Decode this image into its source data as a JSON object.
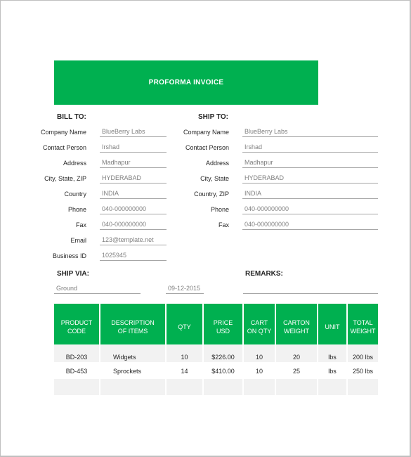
{
  "title": "PROFORMA INVOICE",
  "bill_to": {
    "heading": "BILL TO:",
    "fields": [
      {
        "label": "Company Name",
        "value": "BlueBerry Labs"
      },
      {
        "label": "Contact Person",
        "value": "Irshad"
      },
      {
        "label": "Address",
        "value": "Madhapur"
      },
      {
        "label": "City, State, ZIP",
        "value": "HYDERABAD"
      },
      {
        "label": "Country",
        "value": "INDIA"
      },
      {
        "label": "Phone",
        "value": "040-000000000"
      },
      {
        "label": "Fax",
        "value": "040-000000000"
      },
      {
        "label": "Email",
        "value": "123@template.net"
      },
      {
        "label": "Business ID",
        "value": "1025945"
      }
    ]
  },
  "ship_to": {
    "heading": "SHIP TO:",
    "fields": [
      {
        "label": "Company Name",
        "value": "BlueBerry Labs"
      },
      {
        "label": "Contact Person",
        "value": "Irshad"
      },
      {
        "label": "Address",
        "value": "Madhapur"
      },
      {
        "label": "City, State",
        "value": "HYDERABAD"
      },
      {
        "label": "Country, ZIP",
        "value": "INDIA"
      },
      {
        "label": "Phone",
        "value": "040-000000000"
      },
      {
        "label": "Fax",
        "value": "040-000000000"
      }
    ]
  },
  "ship_via": {
    "heading": "SHIP VIA:",
    "method": "Ground",
    "date": "09-12-2015"
  },
  "remarks": {
    "heading": "REMARKS:",
    "value": ""
  },
  "table": {
    "headers": [
      [
        "PRODUCT",
        "CODE"
      ],
      [
        "DESCRIPTION",
        "OF ITEMS"
      ],
      [
        "QTY"
      ],
      [
        "PRICE",
        "USD"
      ],
      [
        "CART",
        "ON QTY"
      ],
      [
        "CARTON",
        "WEIGHT"
      ],
      [
        "UNIT"
      ],
      [
        "TOTAL",
        "WEIGHT"
      ]
    ],
    "rows": [
      [
        "BD-203",
        "Widgets",
        "10",
        "$226.00",
        "10",
        "20",
        "lbs",
        "200 lbs"
      ],
      [
        "BD-453",
        "Sprockets",
        "14",
        "$410.00",
        "10",
        "25",
        "lbs",
        "250 lbs"
      ],
      [
        "",
        "",
        "",
        "",
        "",
        "",
        "",
        ""
      ]
    ]
  },
  "colors": {
    "accent": "#00b050",
    "row_alt": "#f2f2f2"
  }
}
